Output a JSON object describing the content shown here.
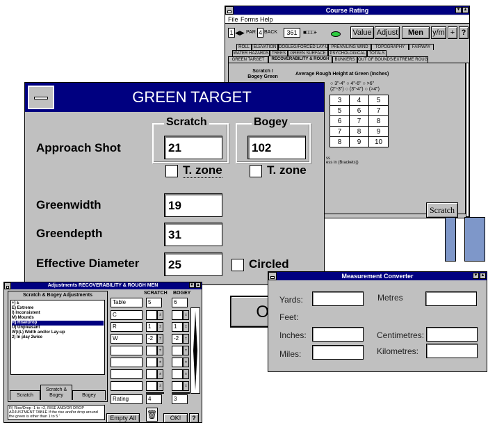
{
  "course_rating": {
    "title": "Course Rating",
    "menu": [
      "File",
      "Forms",
      "Help"
    ],
    "toolbar": {
      "hole": "1",
      "par_label": "PAR",
      "par": "4",
      "back_label": "BACK",
      "yards": "361",
      "value_button": "Value",
      "adjust_button": "Adjust",
      "men_button": "Men",
      "ym_button": "y/m",
      "plus_button": "+",
      "help_button": "?"
    },
    "tabs_row1": [
      "ROLL",
      "ELEVATION",
      "DOGLEG/FORCED LAY-UP",
      "PREVAILING WIND",
      "TOPOGRAPHY",
      "FAIRWAY"
    ],
    "tabs_row2": [
      "WATER HAZARDS",
      "TREES",
      "GREEN SURFACE",
      "PSYCHOLOGICAL",
      "TOTALS"
    ],
    "tabs_row3": [
      "GREEN TARGET",
      "RECOVERABILITY & ROUGH",
      "BUNKERS",
      "OUT OF BOUNDS/EXTREME ROUGH"
    ],
    "sb_header": "Scratch / Bogey Green Target",
    "rough_header": "Average Rough Height at Green (Inches)",
    "radio_top": [
      "3\"-4\"",
      "4\"-6\"",
      ">6\""
    ],
    "radio_bottom": [
      "(2\"-3\")",
      "(3\"-4\")",
      "(>4\")"
    ],
    "grid": [
      [
        "3",
        "4",
        "5"
      ],
      [
        "5",
        "6",
        "7"
      ],
      [
        "6",
        "7",
        "8"
      ],
      [
        "7",
        "8",
        "9"
      ],
      [
        "8",
        "9",
        "10"
      ]
    ],
    "footnote1": "ss",
    "footnote2": "ess in (Brackets))",
    "scratch_button": "Scratch"
  },
  "green_target": {
    "title": "GREEN TARGET",
    "approach_label": "Approach Shot",
    "scratch_group": "Scratch",
    "bogey_group": "Bogey",
    "scratch_value": "21",
    "bogey_value": "102",
    "tzone_label": "T. zone",
    "greenwidth_label": "Greenwidth",
    "greenwidth_value": "19",
    "greendepth_label": "Greendepth",
    "greendepth_value": "31",
    "effdiam_label": "Effective Diameter",
    "effdiam_value": "25",
    "circled_label": "Circled",
    "ok_button": "O"
  },
  "adjustments": {
    "title": "Adjustments RECOVERABILITY & ROUGH MEN",
    "list_header": "Scratch & Bogey Adjustments",
    "list": [
      "+) ±",
      "E) Extreme",
      "I) Inconsistent",
      "M) Mounds",
      "R) Rise/Drop",
      "U) Unpleasant",
      "W)/(L) Width and/or Lay-up",
      "2) In play 2wice"
    ],
    "selected_index": 4,
    "col_scratch": "SCRATCH",
    "col_bogey": "BOGEY",
    "rows": [
      {
        "label": "Table",
        "scratch": "5",
        "bogey": "6"
      },
      {
        "label": "C",
        "scratch": "",
        "bogey": ""
      },
      {
        "label": "R",
        "scratch": "1",
        "bogey": "1"
      },
      {
        "label": "W",
        "scratch": "-2",
        "bogey": "-2"
      },
      {
        "label": "",
        "scratch": "",
        "bogey": ""
      },
      {
        "label": "",
        "scratch": "",
        "bogey": ""
      },
      {
        "label": "",
        "scratch": "",
        "bogey": ""
      },
      {
        "label": "",
        "scratch": "",
        "bogey": ""
      }
    ],
    "rating_label": "Rating",
    "rating_scratch": "4",
    "rating_bogey": "3",
    "tabs": [
      "Scratch",
      "Scratch & Bogey",
      "Bogey"
    ],
    "description": "R) Rise/Drop -1 to +2, RISE AND/OR DROP ADJUSTMENT TABLE If the rise and/or drop around the green is other than 1 to 5 '",
    "empty_all_button": "Empty All",
    "ok_button": "OK!",
    "help_button": "?"
  },
  "converter": {
    "title": "Measurement Converter",
    "labels": {
      "yards": "Yards:",
      "metres": "Metres",
      "feet": "Feet:",
      "inches": "Inches:",
      "centimetres": "Centimetres:",
      "miles": "Miles:",
      "kilometres": "Kilometres:"
    }
  },
  "colors": {
    "titlebar": "#000080",
    "face": "#c0c0c0",
    "accent": "#7e97c9"
  }
}
